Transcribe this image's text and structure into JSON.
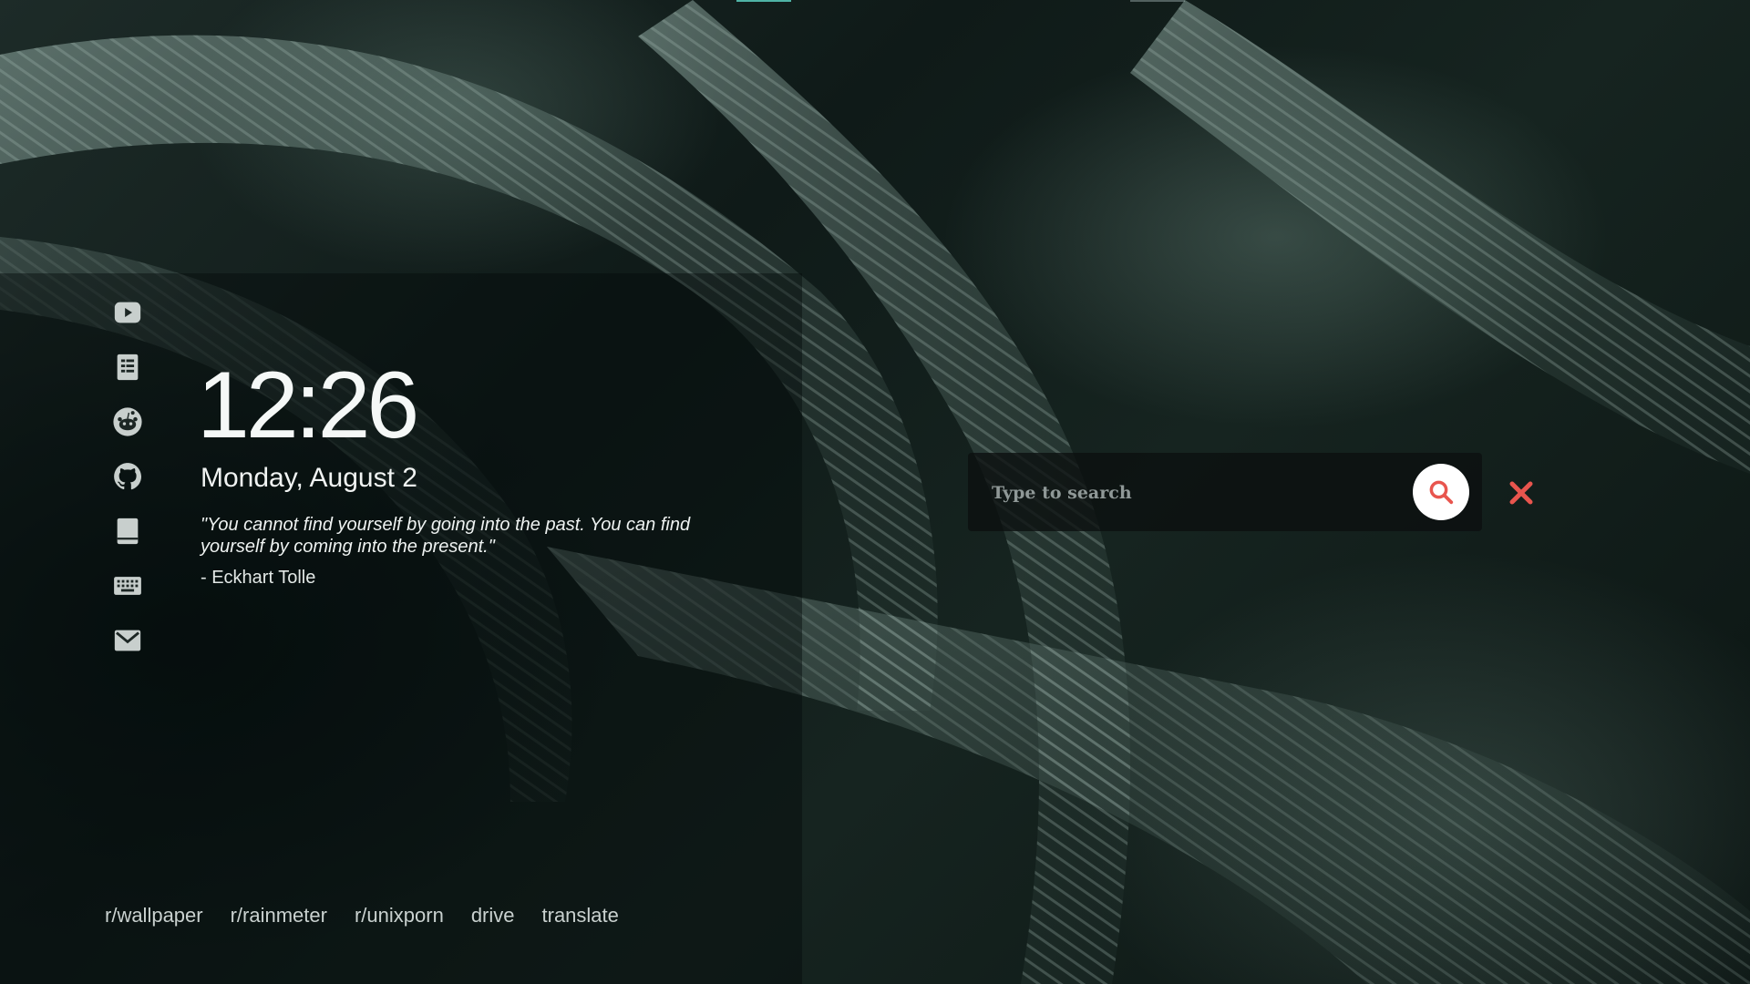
{
  "clock": {
    "time": "12:26",
    "date": "Monday, August 2"
  },
  "quote": {
    "text": "\"You cannot find yourself by going into the past. You can find yourself by coming into the present.\"",
    "author": "- Eckhart Tolle"
  },
  "sidebar": {
    "items": [
      {
        "icon": "youtube-icon"
      },
      {
        "icon": "document-icon"
      },
      {
        "icon": "reddit-icon"
      },
      {
        "icon": "github-icon"
      },
      {
        "icon": "book-icon"
      },
      {
        "icon": "keyboard-icon"
      },
      {
        "icon": "mail-icon"
      }
    ]
  },
  "search": {
    "placeholder": "Type to search",
    "button_icon": "search-icon",
    "clear_icon": "close-icon"
  },
  "links": [
    "r/wallpaper",
    "r/rainmeter",
    "r/unixporn",
    "drive",
    "translate"
  ],
  "colors": {
    "accent": "#4fb3a6",
    "search_icon": "#e8554e",
    "clear_icon": "#e8554e",
    "icon_gray": "#c8cfcd"
  }
}
